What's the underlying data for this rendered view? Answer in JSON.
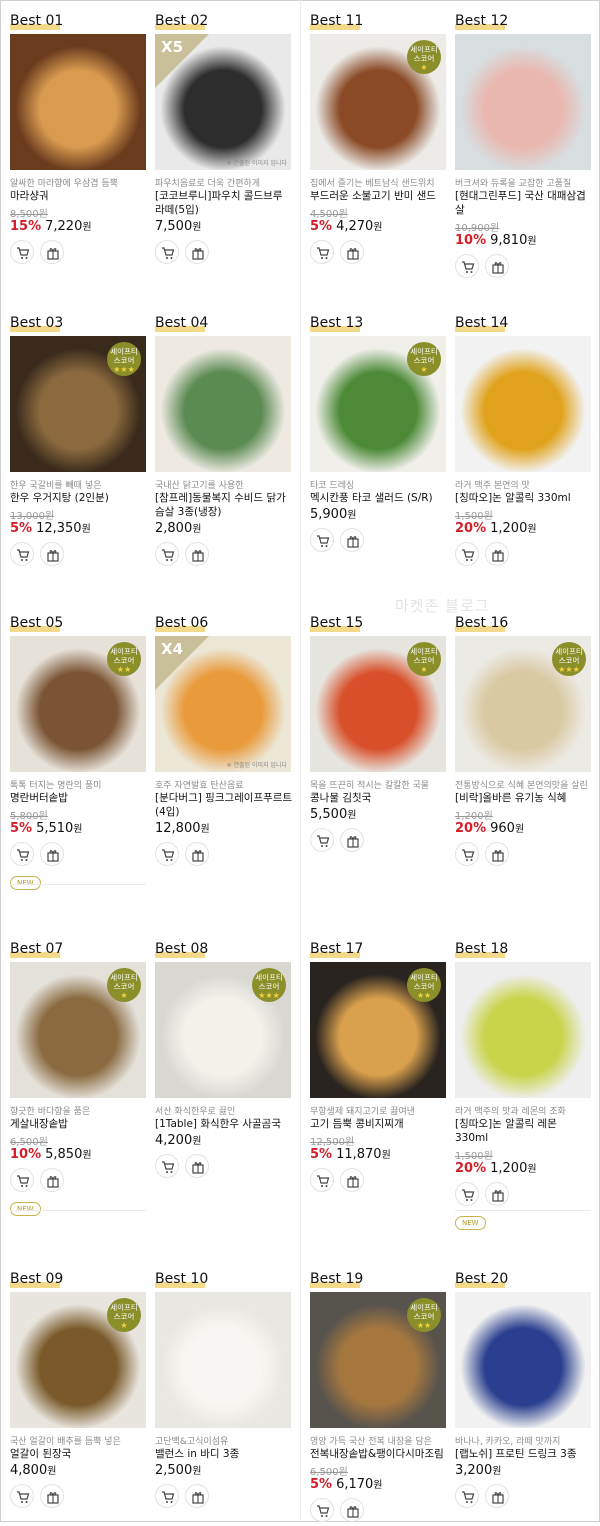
{
  "watermark": "마켓존 블로그",
  "currency": "원",
  "badge": {
    "line1": "세이프티",
    "line2": "스코어"
  },
  "img_note": "※ 연출된 이미지 입니다",
  "new_label": "NEW",
  "products": [
    {
      "rank": "Best 01",
      "sub": "알싸한 마라향에 우삼겹 듬뿍",
      "name": "마라샹궈",
      "orig": "8,500원",
      "pct": "15%",
      "price": "7,220",
      "badge": false,
      "stars": "",
      "tag": "",
      "note": false,
      "new": false,
      "c1": "#6b3b1e",
      "c2": "#d89b4f"
    },
    {
      "rank": "Best 02",
      "sub": "파우치음료로 더욱 간편하게",
      "name": "[코코브루니]파우치 콜드브루 라떼(5입)",
      "orig": "",
      "pct": "",
      "price": "7,500",
      "badge": false,
      "stars": "",
      "tag": "X5",
      "note": true,
      "new": false,
      "c1": "#e9e9e9",
      "c2": "#2d2d2d"
    },
    {
      "rank": "Best 11",
      "sub": "집에서 즐기는 베트남식 샌드위치",
      "name": "부드러운 소불고기 반미 샌드",
      "orig": "4,500원",
      "pct": "5%",
      "price": "4,270",
      "badge": true,
      "stars": "★",
      "tag": "",
      "note": false,
      "new": false,
      "c1": "#ecebe8",
      "c2": "#8a4a25"
    },
    {
      "rank": "Best 12",
      "sub": "버크셔와 듀록을 교잡한 고품질",
      "name": "[현대그린푸드] 국산 대패삼겹살",
      "orig": "10,900원",
      "pct": "10%",
      "price": "9,810",
      "badge": false,
      "stars": "",
      "tag": "",
      "note": false,
      "new": false,
      "c1": "#d8dde0",
      "c2": "#e9b7ae"
    },
    {
      "rank": "Best 03",
      "sub": "한우 국갈비를 빼때 넣은",
      "name": "한우 우거지탕 (2인분)",
      "orig": "13,000원",
      "pct": "5%",
      "price": "12,350",
      "badge": true,
      "stars": "★★★",
      "tag": "",
      "note": false,
      "new": false,
      "c1": "#3a2a1c",
      "c2": "#8b6a3e"
    },
    {
      "rank": "Best 04",
      "sub": "국내산 닭고기를 사용한",
      "name": "[참프레]동물복지 수비드 닭가슴살 3종(냉장)",
      "orig": "",
      "pct": "",
      "price": "2,800",
      "badge": false,
      "stars": "",
      "tag": "",
      "note": false,
      "new": false,
      "c1": "#eeeae2",
      "c2": "#5b8a52"
    },
    {
      "rank": "Best 13",
      "sub": "타코 드레싱",
      "name": "멕시칸풍 타코 샐러드 (S/R)",
      "orig": "",
      "pct": "",
      "price": "5,900",
      "badge": true,
      "stars": "★",
      "tag": "",
      "note": false,
      "new": false,
      "c1": "#f0efea",
      "c2": "#4c8a37"
    },
    {
      "rank": "Best 14",
      "sub": "라거 맥주 본연의 맛",
      "name": "[칭따오]논 알콜릭 330ml",
      "orig": "1,500원",
      "pct": "20%",
      "price": "1,200",
      "badge": false,
      "stars": "",
      "tag": "",
      "note": false,
      "new": false,
      "c1": "#f2f2f2",
      "c2": "#e0a21c"
    },
    {
      "rank": "Best 05",
      "sub": "톡톡 터지는 명란의 풍미",
      "name": "명란버터솥밥",
      "orig": "5,800원",
      "pct": "5%",
      "price": "5,510",
      "badge": true,
      "stars": "★★",
      "tag": "",
      "note": false,
      "new": true,
      "c1": "#e7e2d9",
      "c2": "#7a5434"
    },
    {
      "rank": "Best 06",
      "sub": "호주 자연발효 탄산음료",
      "name": "[분다버그] 핑크그레이프푸르트(4입)",
      "orig": "",
      "pct": "",
      "price": "12,800",
      "badge": false,
      "stars": "",
      "tag": "X4",
      "note": true,
      "new": false,
      "c1": "#ece6d6",
      "c2": "#e99a3a"
    },
    {
      "rank": "Best 15",
      "sub": "목을 뜨끈히 적시는 칼칼한 국물",
      "name": "콩나물 김칫국",
      "orig": "",
      "pct": "",
      "price": "5,500",
      "badge": true,
      "stars": "★",
      "tag": "",
      "note": false,
      "new": false,
      "c1": "#e6e4de",
      "c2": "#d8502a"
    },
    {
      "rank": "Best 16",
      "sub": "전통방식으로 식혜 본연의맛을 살린",
      "name": "[비락]올바른 유기농 식혜",
      "orig": "1,200원",
      "pct": "20%",
      "price": "960",
      "badge": true,
      "stars": "★★★",
      "tag": "",
      "note": false,
      "new": false,
      "c1": "#eceae4",
      "c2": "#d9c9a2"
    },
    {
      "rank": "Best 07",
      "sub": "향긋한 바다향을 품은",
      "name": "게살내장솥밥",
      "orig": "6,500원",
      "pct": "10%",
      "price": "5,850",
      "badge": true,
      "stars": "★",
      "tag": "",
      "note": false,
      "new": true,
      "c1": "#e4e1da",
      "c2": "#8a6a3f"
    },
    {
      "rank": "Best 08",
      "sub": "서산 화식한우로 끓인",
      "name": "[1Table] 화식한우 사골곰국",
      "orig": "",
      "pct": "",
      "price": "4,200",
      "badge": true,
      "stars": "★★★",
      "tag": "",
      "note": false,
      "new": false,
      "c1": "#d9d7d2",
      "c2": "#f3f1ea"
    },
    {
      "rank": "Best 17",
      "sub": "무항생제 돼지고기로 끓여낸",
      "name": "고기 듬뿍 콩비지찌개",
      "orig": "12,500원",
      "pct": "5%",
      "price": "11,870",
      "badge": true,
      "stars": "★★",
      "tag": "",
      "note": false,
      "new": false,
      "c1": "#2a2420",
      "c2": "#d9a04d"
    },
    {
      "rank": "Best 18",
      "sub": "라거 맥주의 맛과 레몬의 조화",
      "name": "[칭따오]논 알콜릭 레몬 330ml",
      "orig": "1,500원",
      "pct": "20%",
      "price": "1,200",
      "badge": false,
      "stars": "",
      "tag": "",
      "note": false,
      "new": true,
      "c1": "#eeeeee",
      "c2": "#c8d44a"
    },
    {
      "rank": "Best 09",
      "sub": "국산 얼갈이 배추를 듬뿍 넣은",
      "name": "얼갈이 된장국",
      "orig": "",
      "pct": "",
      "price": "4,800",
      "badge": true,
      "stars": "★",
      "tag": "",
      "note": false,
      "new": false,
      "c1": "#e8e5de",
      "c2": "#7a5a2a"
    },
    {
      "rank": "Best 10",
      "sub": "고단백&고식이섬유",
      "name": "밸런스 in 바디 3종",
      "orig": "",
      "pct": "",
      "price": "2,500",
      "badge": false,
      "stars": "",
      "tag": "",
      "note": false,
      "new": false,
      "c1": "#e9e7e1",
      "c2": "#f7f6f2"
    },
    {
      "rank": "Best 19",
      "sub": "영양 가득 국산 전복 내장을 담은",
      "name": "전복내장솥밥&팽이다시마조림",
      "orig": "6,500원",
      "pct": "5%",
      "price": "6,170",
      "badge": true,
      "stars": "★★",
      "tag": "",
      "note": false,
      "new": false,
      "c1": "#57534d",
      "c2": "#a5773f"
    },
    {
      "rank": "Best 20",
      "sub": "바나나, 카카오, 라떼 맛까지",
      "name": "[랩노쉬] 프로틴 드링크 3종",
      "orig": "",
      "pct": "",
      "price": "3,200",
      "badge": false,
      "stars": "",
      "tag": "",
      "note": false,
      "new": false,
      "c1": "#f1f1f1",
      "c2": "#2a3f8f"
    }
  ]
}
